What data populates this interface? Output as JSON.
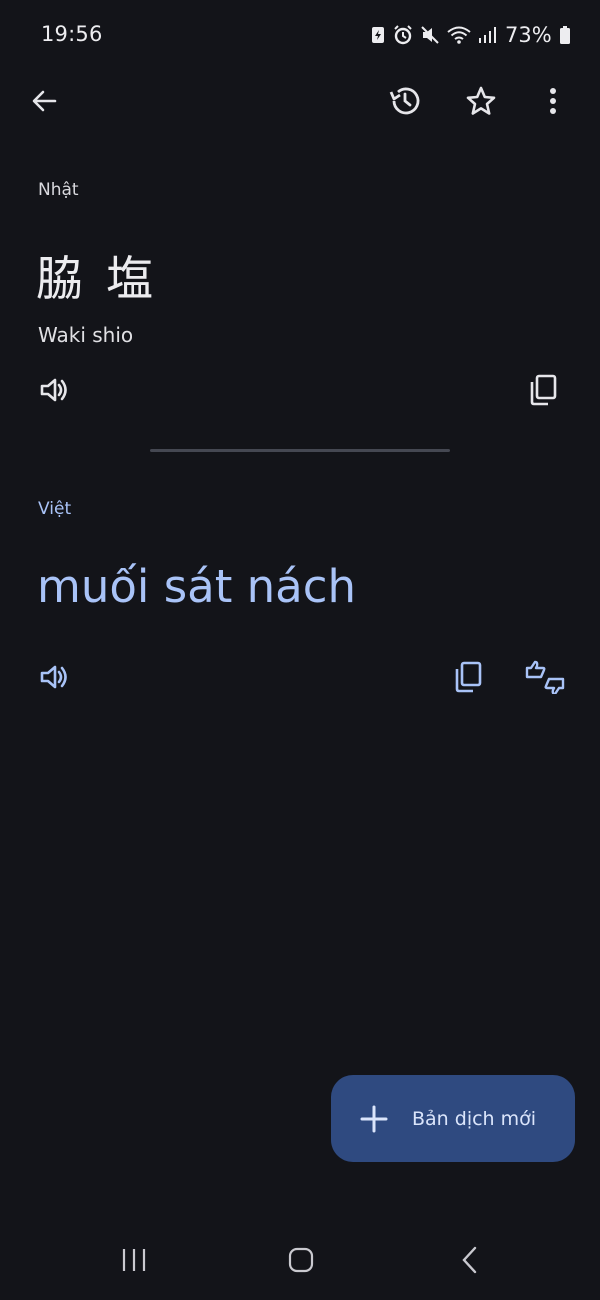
{
  "status_bar": {
    "time": "19:56",
    "battery": "73%",
    "icons": [
      "battery-saver-icon",
      "alarm-icon",
      "mute-icon",
      "wifi-icon",
      "signal-icon",
      "battery-icon"
    ]
  },
  "toolbar": {
    "back_icon": "arrow-back-icon",
    "history_icon": "history-icon",
    "favorite_icon": "star-icon",
    "more_icon": "more-vert-icon"
  },
  "source": {
    "language": "Nhật",
    "text": "脇 塩",
    "transliteration": "Waki shio"
  },
  "target": {
    "language": "Việt",
    "text": "muối sát nách"
  },
  "fab": {
    "label": "Bản dịch mới"
  },
  "colors": {
    "background": "#131419",
    "accent_text": "#a9c3f7",
    "fab_bg": "#2f4a80"
  }
}
